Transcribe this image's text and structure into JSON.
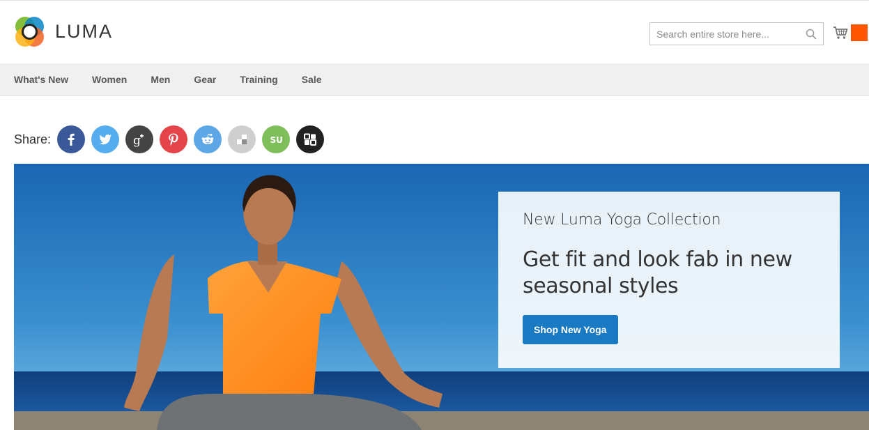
{
  "brand": {
    "name": "LUMA"
  },
  "search": {
    "placeholder": "Search entire store here...",
    "value": ""
  },
  "cart": {
    "icon": "cart-icon",
    "badge_color": "#ff5501"
  },
  "nav": {
    "items": [
      {
        "label": "What's New"
      },
      {
        "label": "Women"
      },
      {
        "label": "Men"
      },
      {
        "label": "Gear"
      },
      {
        "label": "Training"
      },
      {
        "label": "Sale"
      }
    ]
  },
  "share": {
    "label": "Share:",
    "buttons": [
      {
        "name": "facebook",
        "icon": "facebook-icon",
        "color": "#3b5998"
      },
      {
        "name": "twitter",
        "icon": "twitter-icon",
        "color": "#55acee"
      },
      {
        "name": "google-plus",
        "icon": "google-plus-icon",
        "color": "#444444"
      },
      {
        "name": "pinterest",
        "icon": "pinterest-icon",
        "color": "#e4444a"
      },
      {
        "name": "reddit",
        "icon": "reddit-icon",
        "color": "#5da7e6"
      },
      {
        "name": "delicious",
        "icon": "delicious-icon",
        "color": "#cfcfcf"
      },
      {
        "name": "stumbleupon",
        "icon": "stumbleupon-icon",
        "color": "#7fbf5b"
      },
      {
        "name": "digg",
        "icon": "digg-icon",
        "color": "#222222"
      }
    ]
  },
  "hero": {
    "kicker": "New Luma Yoga Collection",
    "title": "Get fit and look fab in new seasonal styles",
    "button_label": "Shop New Yoga",
    "accent_color": "#1979c3"
  }
}
